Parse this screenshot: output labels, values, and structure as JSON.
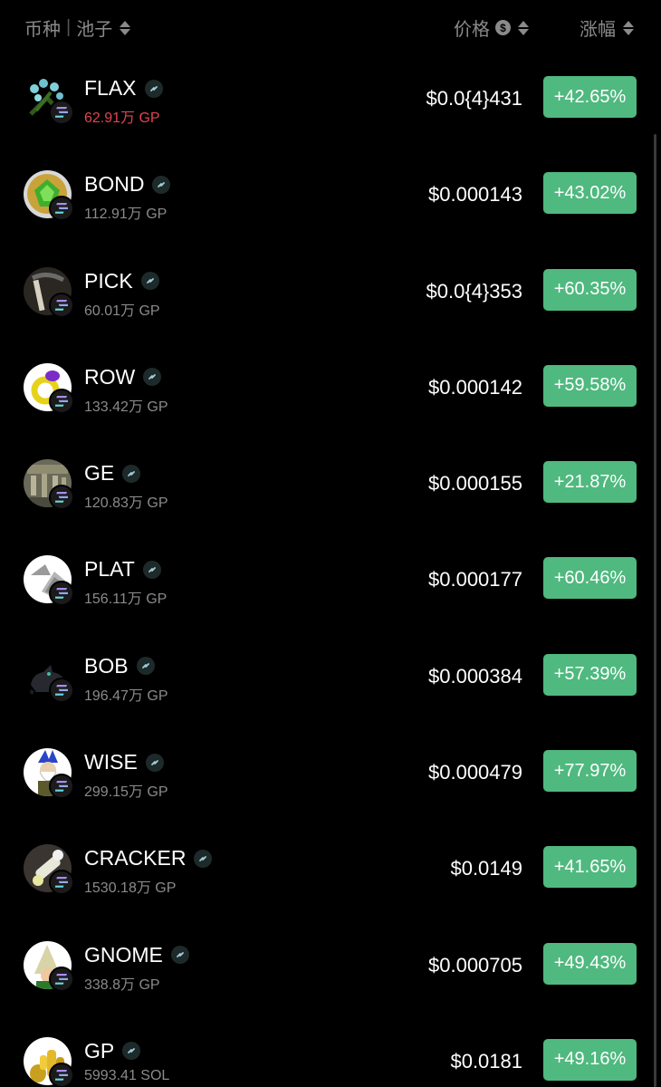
{
  "header": {
    "coin_label": "币种",
    "pool_label": "池子",
    "price_label": "价格",
    "change_label": "涨幅"
  },
  "colors": {
    "positive_badge": "#4fb97f",
    "pool_warning": "#e0454f",
    "muted_text": "#8a8a8a"
  },
  "tokens": [
    {
      "symbol": "FLAX",
      "pool": "62.91万 GP",
      "price": "$0.0{4}431",
      "change": "+42.65%",
      "pool_warning": true,
      "icon": "flax-plant-icon"
    },
    {
      "symbol": "BOND",
      "pool": "112.91万 GP",
      "price": "$0.000143",
      "change": "+43.02%",
      "pool_warning": false,
      "icon": "bond-gem-icon"
    },
    {
      "symbol": "PICK",
      "pool": "60.01万 GP",
      "price": "$0.0{4}353",
      "change": "+60.35%",
      "pool_warning": false,
      "icon": "pickaxe-icon"
    },
    {
      "symbol": "ROW",
      "pool": "133.42万 GP",
      "price": "$0.000142",
      "change": "+59.58%",
      "pool_warning": false,
      "icon": "ring-icon"
    },
    {
      "symbol": "GE",
      "pool": "120.83万 GP",
      "price": "$0.000155",
      "change": "+21.87%",
      "pool_warning": false,
      "icon": "exchange-crowd-icon"
    },
    {
      "symbol": "PLAT",
      "pool": "156.11万 GP",
      "price": "$0.000177",
      "change": "+60.46%",
      "pool_warning": false,
      "icon": "plate-armor-icon"
    },
    {
      "symbol": "BOB",
      "pool": "196.47万 GP",
      "price": "$0.000384",
      "change": "+57.39%",
      "pool_warning": false,
      "icon": "cat-icon"
    },
    {
      "symbol": "WISE",
      "pool": "299.15万 GP",
      "price": "$0.000479",
      "change": "+77.97%",
      "pool_warning": false,
      "icon": "wise-old-man-icon"
    },
    {
      "symbol": "CRACKER",
      "pool": "1530.18万 GP",
      "price": "$0.0149",
      "change": "+41.65%",
      "pool_warning": false,
      "icon": "cracker-icon"
    },
    {
      "symbol": "GNOME",
      "pool": "338.8万 GP",
      "price": "$0.000705",
      "change": "+49.43%",
      "pool_warning": false,
      "icon": "gnome-hat-icon"
    },
    {
      "symbol": "GP",
      "pool": "5993.41 SOL",
      "price": "$0.0181",
      "change": "+49.16%",
      "pool_warning": false,
      "icon": "gold-coins-icon"
    }
  ]
}
